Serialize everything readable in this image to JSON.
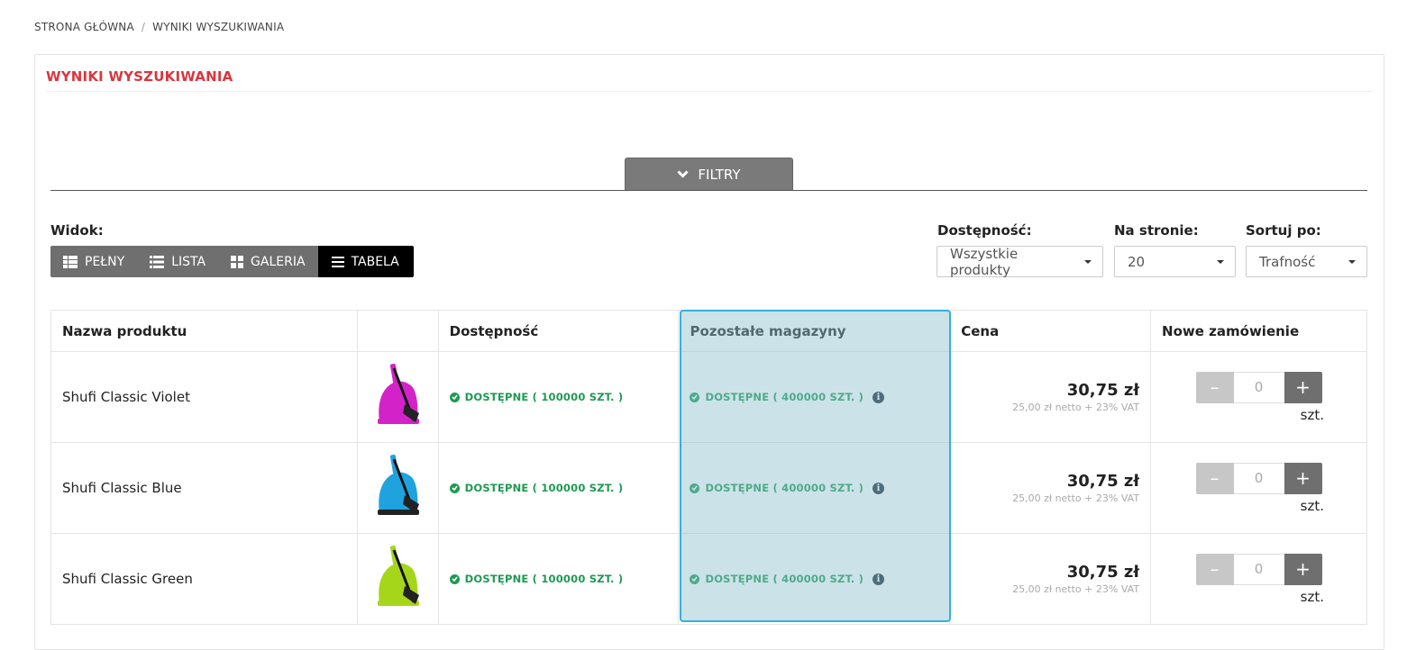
{
  "breadcrumb": {
    "home": "STRONA GŁÓWNA",
    "separator": "/",
    "current": "WYNIKI WYSZUKIWANIA"
  },
  "panel": {
    "title": "WYNIKI WYSZUKIWANIA"
  },
  "filters": {
    "label": "FILTRY",
    "icon": "chevron-down-icon"
  },
  "view": {
    "label": "Widok:",
    "options": [
      {
        "label": "PEŁNY",
        "icon": "full-view-icon"
      },
      {
        "label": "LISTA",
        "icon": "list-view-icon"
      },
      {
        "label": "GALERIA",
        "icon": "gallery-view-icon"
      },
      {
        "label": "TABELA",
        "icon": "table-view-icon",
        "active": true
      }
    ]
  },
  "availability_filter": {
    "label": "Dostępność:",
    "value": "Wszystkie produkty"
  },
  "per_page": {
    "label": "Na stronie:",
    "value": "20"
  },
  "sort": {
    "label": "Sortuj po:",
    "value": "Trafność"
  },
  "table": {
    "headers": [
      "Nazwa produktu",
      "",
      "Dostępność",
      "Pozostałe magazyny",
      "Cena",
      "Nowe zamówienie"
    ],
    "rows": [
      {
        "name": "Shufi Classic Violet",
        "color": "#d323c8",
        "availability": "DOSTĘPNE ( 100000 SZT. )",
        "other_stock": "DOSTĘPNE ( 400000 SZT. )",
        "price": "30,75 zł",
        "price_sub": "25,00 zł netto + 23% VAT",
        "minus": "–",
        "qty": "0",
        "plus": "+",
        "unit": "szt."
      },
      {
        "name": "Shufi Classic Blue",
        "color": "#1fa3df",
        "availability": "DOSTĘPNE ( 100000 SZT. )",
        "other_stock": "DOSTĘPNE ( 400000 SZT. )",
        "price": "30,75 zł",
        "price_sub": "25,00 zł netto + 23% VAT",
        "minus": "–",
        "qty": "0",
        "plus": "+",
        "unit": "szt."
      },
      {
        "name": "Shufi Classic Green",
        "color": "#a6d61a",
        "availability": "DOSTĘPNE ( 100000 SZT. )",
        "other_stock": "DOSTĘPNE ( 400000 SZT. )",
        "price": "30,75 zł",
        "price_sub": "25,00 zł netto + 23% VAT",
        "minus": "–",
        "qty": "0",
        "plus": "+",
        "unit": "szt."
      }
    ]
  },
  "colors": {
    "accent_red": "#d9363e",
    "available_green": "#1e9a52",
    "highlight_border": "#35b0e0"
  }
}
